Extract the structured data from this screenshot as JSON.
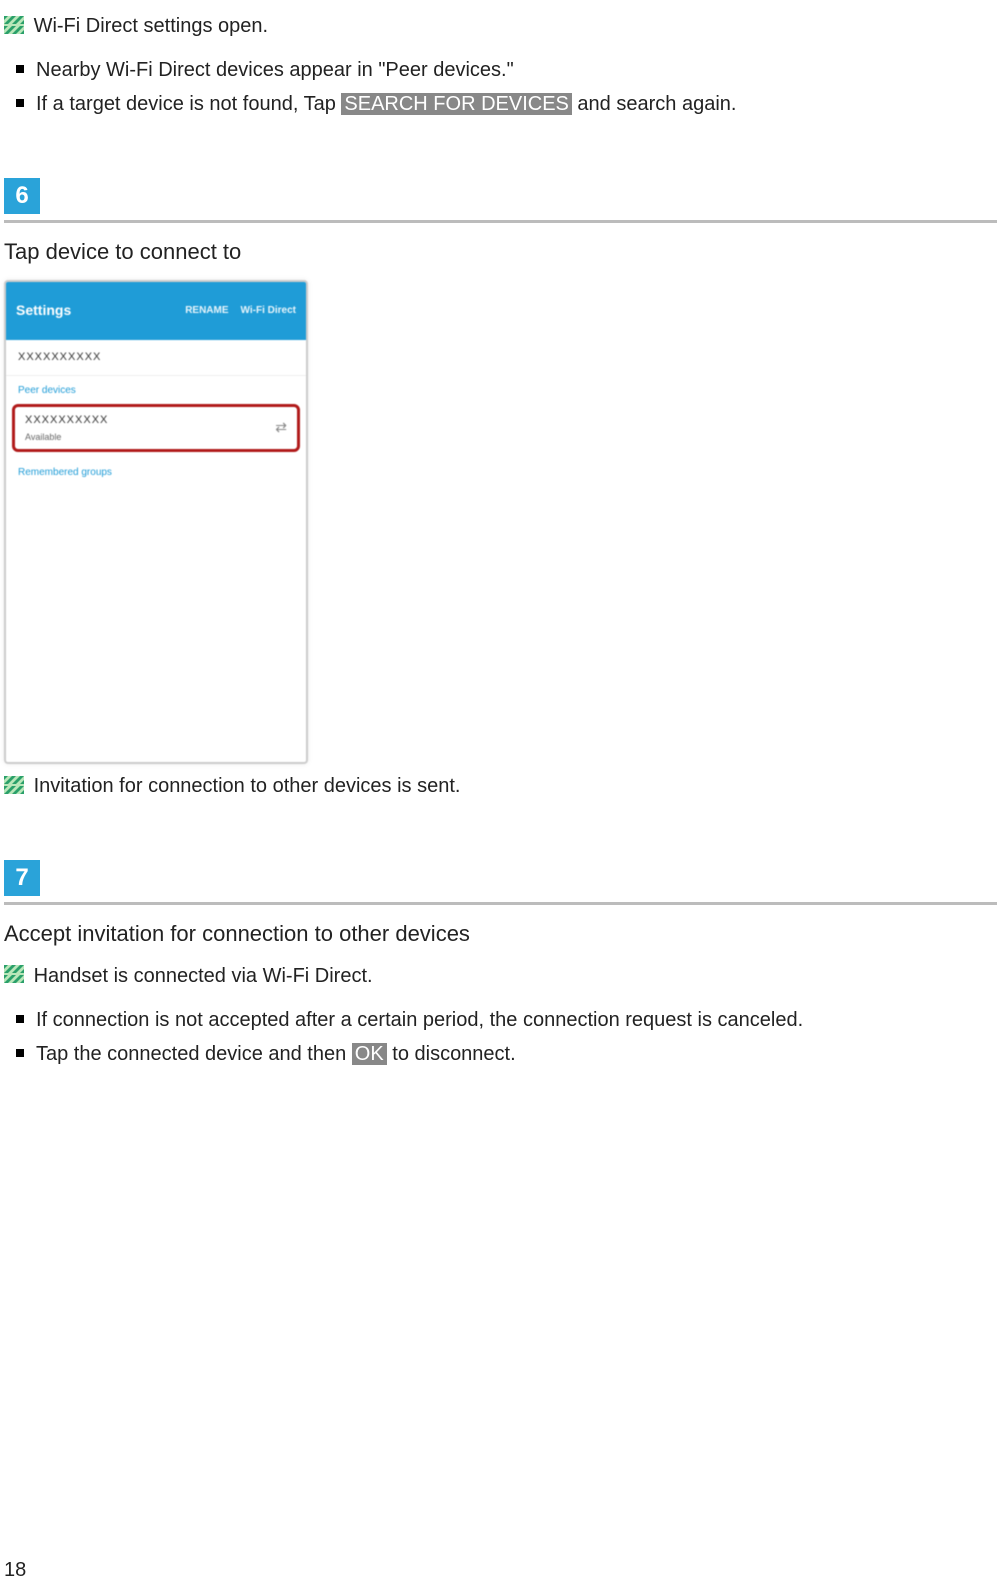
{
  "intro": {
    "result_text": "Wi-Fi Direct settings open.",
    "bullets": [
      {
        "pre": "Nearby Wi-Fi Direct devices appear in \"Peer devices.\"",
        "button": null,
        "post": null
      },
      {
        "pre": "If a target device is not found, Tap ",
        "button": "SEARCH FOR DEVICES",
        "post": " and search again."
      }
    ]
  },
  "step6": {
    "number": "6",
    "title": "Tap device to connect to",
    "phone": {
      "header_title": "Settings",
      "header_action_1": "RENAME",
      "header_action_2": "Wi-Fi Direct",
      "device_name": "XXXXXXXXXX",
      "section_peer": "Peer devices",
      "peer_name": "XXXXXXXXXX",
      "peer_status": "Available",
      "section_groups": "Remembered groups"
    },
    "result_text": "Invitation for connection to other devices is sent."
  },
  "step7": {
    "number": "7",
    "title": "Accept invitation for connection to other devices",
    "result_text": "Handset is connected via Wi-Fi Direct.",
    "bullets": [
      {
        "pre": "If connection is not accepted after a certain period, the connection request is canceled.",
        "button": null,
        "post": null
      },
      {
        "pre": "Tap the connected device and then ",
        "button": "OK",
        "post": " to disconnect."
      }
    ]
  },
  "page_number": "18"
}
